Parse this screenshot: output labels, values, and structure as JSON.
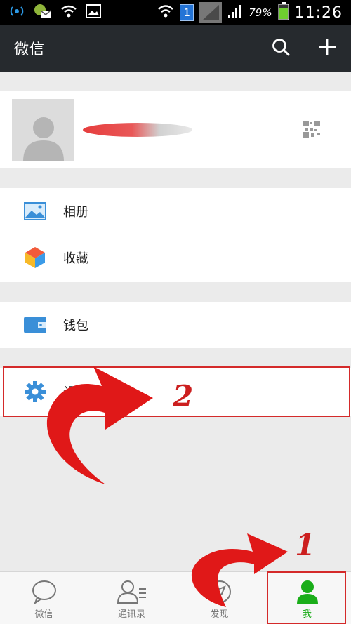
{
  "status_bar": {
    "battery_percent": "79%",
    "time": "11:26",
    "sim_badge": "1"
  },
  "action_bar": {
    "title": "微信",
    "search_icon": "search-icon",
    "add_icon": "plus-icon"
  },
  "menu": {
    "album": "相册",
    "favorites": "收藏",
    "wallet": "钱包",
    "settings": "设置"
  },
  "annotations": {
    "step1": "1",
    "step2": "2"
  },
  "tabs": [
    {
      "label": "微信",
      "icon": "chat-bubble-icon",
      "active": false
    },
    {
      "label": "通讯录",
      "icon": "contacts-icon",
      "active": false
    },
    {
      "label": "发现",
      "icon": "compass-icon",
      "active": false
    },
    {
      "label": "我",
      "icon": "me-person-icon",
      "active": true
    }
  ],
  "colors": {
    "action_bar_bg": "#262a2e",
    "accent_green": "#1aad19",
    "icon_blue": "#3a8fd8",
    "annotation_red": "#d42a2a"
  }
}
